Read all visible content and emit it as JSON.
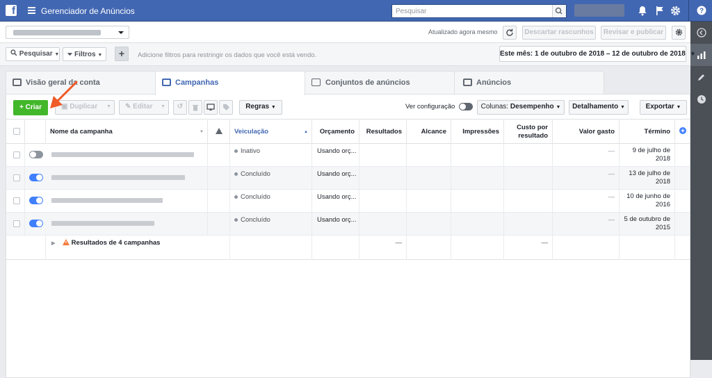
{
  "topbar": {
    "app_title": "Gerenciador de Anúncios",
    "search_placeholder": "Pesquisar",
    "icons": [
      "bell-icon",
      "flag-icon",
      "gear-icon",
      "help-icon"
    ]
  },
  "header": {
    "updated_text": "Atualizado agora mesmo",
    "discard_label": "Descartar rascunhos",
    "review_label": "Revisar e publicar"
  },
  "filters": {
    "search_label": "Pesquisar",
    "filters_label": "Filtros",
    "hint": "Adicione filtros para restringir os dados que você está vendo.",
    "date_range": "Este mês: 1 de outubro de 2018 – 12 de outubro de 2018"
  },
  "tabs": [
    {
      "label": "Visão geral da conta"
    },
    {
      "label": "Campanhas"
    },
    {
      "label": "Conjuntos de anúncios"
    },
    {
      "label": "Anúncios"
    }
  ],
  "toolbar": {
    "create_label": "Criar",
    "duplicate_label": "Duplicar",
    "edit_label": "Editar",
    "rules_label": "Regras",
    "view_config_label": "Ver configuração",
    "columns_label": "Colunas:",
    "columns_value": "Desempenho",
    "breakdown_label": "Detalhamento",
    "export_label": "Exportar"
  },
  "table": {
    "columns": {
      "name": "Nome da campanha",
      "delivery": "Veiculação",
      "budget": "Orçamento",
      "results": "Resultados",
      "reach": "Alcance",
      "impressions": "Impressões",
      "cost_line1": "Custo por",
      "cost_line2": "resultado",
      "spent": "Valor gasto",
      "end": "Término"
    },
    "rows": [
      {
        "delivery": "Inativo",
        "budget": "Usando orç...",
        "spent": "—",
        "end_line1": "9 de julho de",
        "end_line2": "2018",
        "active": false
      },
      {
        "delivery": "Concluído",
        "budget": "Usando orç...",
        "spent": "—",
        "end_line1": "13 de julho de",
        "end_line2": "2018",
        "active": true
      },
      {
        "delivery": "Concluído",
        "budget": "Usando orç...",
        "spent": "—",
        "end_line1": "10 de junho de",
        "end_line2": "2016",
        "active": true
      },
      {
        "delivery": "Concluído",
        "budget": "Usando orç...",
        "spent": "—",
        "end_line1": "5 de outubro de",
        "end_line2": "2015",
        "active": true
      }
    ],
    "summary": {
      "label": "Resultados de 4 campanhas",
      "results": "—",
      "cost": "—"
    }
  },
  "colors": {
    "brand": "#4267b2",
    "create": "#42b72a",
    "toggle_on": "#4080ff",
    "arrow": "#f05a28"
  }
}
